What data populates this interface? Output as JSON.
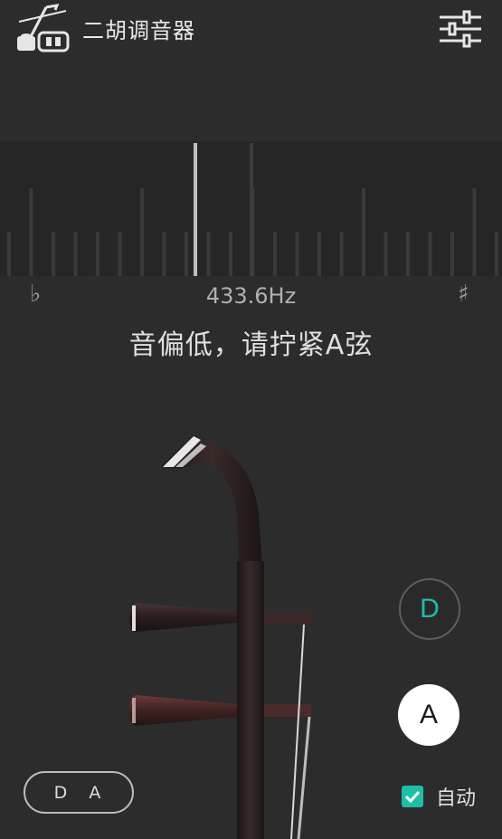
{
  "header": {
    "title": "二胡调音器",
    "app_icon": "erhu-logo-icon",
    "settings_icon": "sliders-icon"
  },
  "meter": {
    "flat_symbol": "♭",
    "sharp_symbol": "♯",
    "frequency": "433.6Hz",
    "hint": "音偏低，请拧紧A弦"
  },
  "strings": {
    "d_label": "D",
    "a_label": "A",
    "selected": "A"
  },
  "tuning": {
    "label": "D A"
  },
  "auto": {
    "label": "自动",
    "checked": true
  },
  "colors": {
    "background": "#2c2c2c",
    "meter_bg": "#262626",
    "accent": "#1fbfa6",
    "text": "#e0e0e0"
  }
}
